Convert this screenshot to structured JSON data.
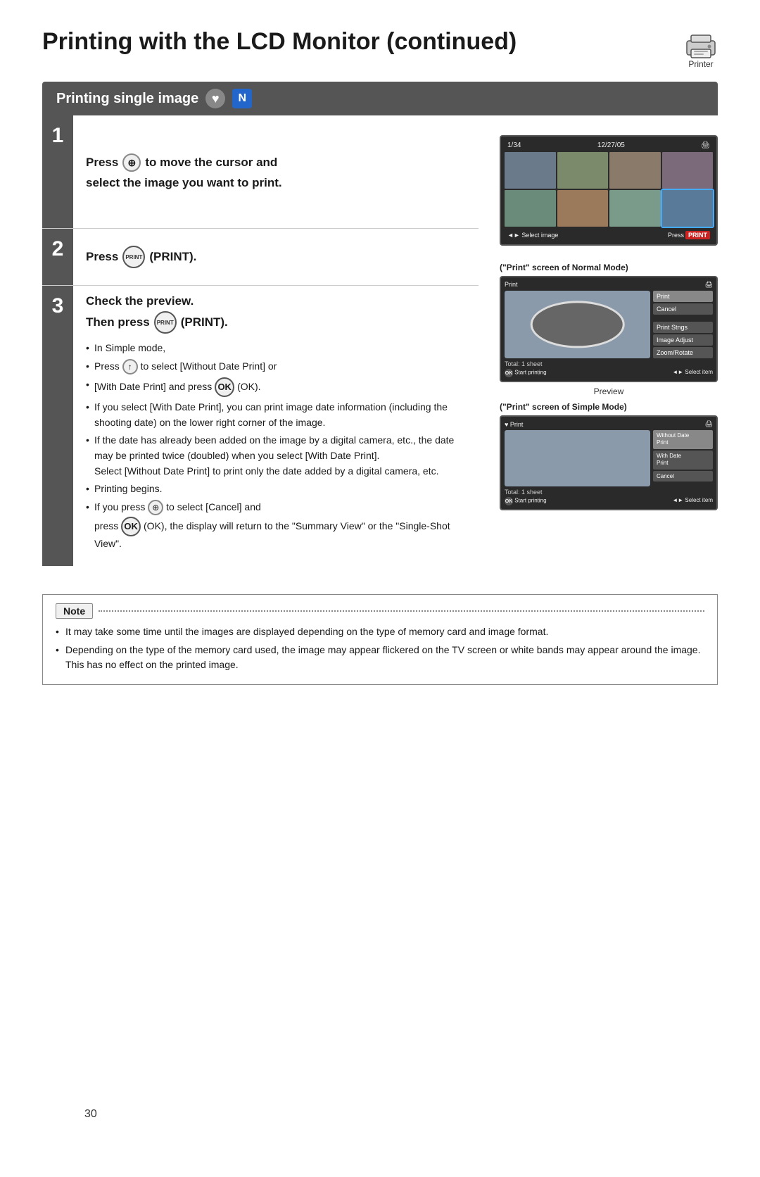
{
  "page": {
    "title": "Printing with the LCD Monitor (continued)",
    "printer_label": "Printer",
    "page_number": "30"
  },
  "section": {
    "header": "Printing single image"
  },
  "steps": [
    {
      "number": "1",
      "text_line1": "Press",
      "text_line2": "to move the cursor and",
      "text_line3": "select the image you want to print."
    },
    {
      "number": "2",
      "text": "Press",
      "text2": "(PRINT)."
    },
    {
      "number": "3",
      "header1": "Check the preview.",
      "header2": "Then press",
      "header2b": "(PRINT).",
      "bullets": [
        "In Simple mode,",
        "to select [Without Date Print] or",
        "[With Date Print] and press",
        "(OK).",
        "If you select [With Date Print], you can print image date information (including the shooting date) on the lower right corner of the image.",
        "If the date has already been added on the image by a digital camera, etc., the date may be printed twice (doubled) when you select [With Date Print].",
        "Select [Without Date Print] to print only the date added by a digital camera, etc.",
        "Printing begins.",
        "If you press",
        "to select [Cancel] and",
        "press",
        "(OK), the display will return to the \"Summary View\" or the \"Single-Shot View\"."
      ]
    }
  ],
  "screen1": {
    "top_left": "1/34",
    "top_right": "12/27/05",
    "bottom_left": "◄► Select image",
    "bottom_right": "Press PRINT"
  },
  "screen_normal": {
    "label": "(\"Print\" screen of Normal Mode)",
    "top_left": "Print",
    "menu_items": [
      "Print",
      "Cancel",
      "",
      "Print Stngs",
      "Image Adjust",
      "Zoom/Rotate"
    ],
    "total": "Total:  1 sheet",
    "bottom_left": "OK Start printing",
    "bottom_right": "◄► Select item"
  },
  "screen_preview_label": "Preview",
  "screen_simple": {
    "label": "(\"Print\" screen of Simple Mode)",
    "top_left": "♥ Print",
    "menu_items": [
      "Without Date Print",
      "With Date Print",
      "Cancel"
    ],
    "total": "Total:  1 sheet",
    "bottom_left": "OK Start printing",
    "bottom_right": "◄► Select item"
  },
  "note": {
    "label": "Note",
    "bullets": [
      "It may take some time until the images are displayed depending on the type of memory card and image format.",
      "Depending on the type of the memory card used, the image may appear flickered on the TV screen or white bands may appear around the image. This has no effect on the printed image."
    ]
  }
}
